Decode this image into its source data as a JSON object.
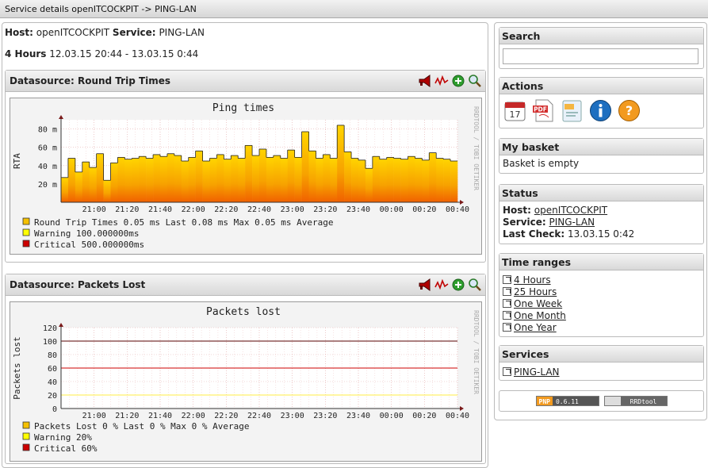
{
  "topbar": {
    "title": "Service details openITCOCKPIT -> PING-LAN"
  },
  "info": {
    "host_label": "Host:",
    "host_value": "openITCOCKPIT",
    "service_label": "Service:",
    "service_value": "PING-LAN",
    "range_label": "4 Hours",
    "range_value": "12.03.15 20:44 - 13.03.15 0:44"
  },
  "colors": {
    "accent_link": "#222222",
    "area_fill": "#f5b400",
    "warning": "#ffff00",
    "critical": "#cc0000"
  },
  "datasources": [
    {
      "title": "Datasource: Round Trip Times",
      "icons": [
        "alert-horn-icon",
        "graph-icon",
        "add-icon",
        "zoom-icon"
      ],
      "graph": {
        "title": "Ping times",
        "ylabel": "RTA",
        "watermark": "RRDTOOL / TOBI OETIKER",
        "yticks": [
          "80 m",
          "60 m",
          "40 m",
          "20 m"
        ],
        "xticks": [
          "21:00",
          "21:20",
          "21:40",
          "22:00",
          "22:20",
          "22:40",
          "23:00",
          "23:20",
          "23:40",
          "00:00",
          "00:20",
          "00:40"
        ],
        "legend": [
          {
            "label": "Round Trip Times",
            "stats": "0.05 ms Last     0.08 ms Max     0.05 ms Average",
            "color": "#f5c000"
          },
          {
            "label": "Warning",
            "stats": "100.000000ms",
            "color": "#ffff00"
          },
          {
            "label": "Critical",
            "stats": "500.000000ms",
            "color": "#cc0000"
          }
        ]
      }
    },
    {
      "title": "Datasource: Packets Lost",
      "icons": [
        "alert-horn-icon",
        "graph-icon",
        "add-icon",
        "zoom-icon"
      ],
      "graph": {
        "title": "Packets lost",
        "ylabel": "Packets lost",
        "watermark": "RRDTOOL / TOBI OETIKER",
        "yticks": [
          "120",
          "100",
          "80",
          "60",
          "40",
          "20",
          "0"
        ],
        "xticks": [
          "21:00",
          "21:20",
          "21:40",
          "22:00",
          "22:20",
          "22:40",
          "23:00",
          "23:20",
          "23:40",
          "00:00",
          "00:20",
          "00:40"
        ],
        "legend": [
          {
            "label": "Packets Lost",
            "stats": "0 % Last     0 % Max     0 % Average",
            "color": "#f5c000"
          },
          {
            "label": "Warning",
            "stats": "20%",
            "color": "#ffff00"
          },
          {
            "label": "Critical",
            "stats": "60%",
            "color": "#cc0000"
          }
        ]
      }
    }
  ],
  "chart_data": [
    {
      "type": "area",
      "title": "Ping times",
      "ylabel": "RTA",
      "x_labels": [
        "21:00",
        "21:20",
        "21:40",
        "22:00",
        "22:20",
        "22:40",
        "23:00",
        "23:20",
        "23:40",
        "00:00",
        "00:20",
        "00:40"
      ],
      "ylim": [
        0,
        90
      ],
      "values": [
        27,
        48,
        33,
        44,
        38,
        53,
        24,
        43,
        49,
        47,
        48,
        50,
        48,
        52,
        50,
        53,
        51,
        45,
        49,
        56,
        45,
        48,
        52,
        47,
        51,
        48,
        62,
        51,
        58,
        49,
        51,
        48,
        57,
        49,
        77,
        56,
        48,
        52,
        48,
        84,
        55,
        48,
        46,
        37,
        50,
        47,
        49,
        48,
        47,
        50,
        48,
        46,
        54,
        48,
        47,
        45
      ]
    },
    {
      "type": "line",
      "title": "Packets lost",
      "ylabel": "Packets lost",
      "x_labels": [
        "21:00",
        "21:20",
        "21:40",
        "22:00",
        "22:20",
        "22:40",
        "23:00",
        "23:20",
        "23:40",
        "00:00",
        "00:20",
        "00:40"
      ],
      "ylim": [
        0,
        120
      ],
      "series": [
        {
          "name": "Packets Lost",
          "value": 0
        },
        {
          "name": "Warning",
          "value": 20
        },
        {
          "name": "Critical",
          "value": 60
        }
      ],
      "extra_line": 100
    }
  ],
  "sidebar": {
    "search": {
      "title": "Search",
      "placeholder": ""
    },
    "actions": {
      "title": "Actions",
      "icons": [
        "calendar-icon",
        "pdf-icon",
        "xml-icon",
        "info-icon",
        "help-icon"
      ]
    },
    "basket": {
      "title": "My basket",
      "text": "Basket is empty"
    },
    "status": {
      "title": "Status",
      "host_label": "Host:",
      "host_value": "openITCOCKPIT",
      "service_label": "Service:",
      "service_value": "PING-LAN",
      "check_label": "Last Check:",
      "check_value": "13.03.15 0:42"
    },
    "time_ranges": {
      "title": "Time ranges",
      "items": [
        "4 Hours",
        "25 Hours",
        "One Week",
        "One Month",
        "One Year"
      ]
    },
    "services": {
      "title": "Services",
      "items": [
        "PING-LAN"
      ]
    },
    "footer": {
      "pnp_label": "PNP",
      "pnp_version": "0.6.11",
      "rrd_label": "RRDtool"
    }
  }
}
